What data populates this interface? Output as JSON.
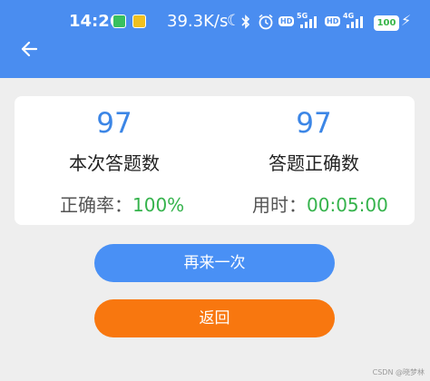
{
  "status_bar": {
    "time": "14:26",
    "net_speed": "39.3K/s",
    "hd_label": "HD",
    "net1": "5G",
    "net2": "4G",
    "battery": "100"
  },
  "toolbar": {
    "back_icon": "arrow-left-icon"
  },
  "summary": {
    "total_count": "97",
    "total_label": "本次答题数",
    "correct_count": "97",
    "correct_label": "答题正确数",
    "accuracy_key": "正确率：",
    "accuracy_value": "100%",
    "time_key": "用时：",
    "time_value": "00:05:00"
  },
  "actions": {
    "again_label": "再来一次",
    "back_label": "返回"
  },
  "watermark": "CSDN @晓梦林",
  "colors": {
    "appbar": "#4a8df0",
    "accent_blue": "#3c86e6",
    "success_green": "#35b34c",
    "primary_button": "#4990f5",
    "secondary_button": "#f8770f",
    "background": "#eeeeee"
  }
}
